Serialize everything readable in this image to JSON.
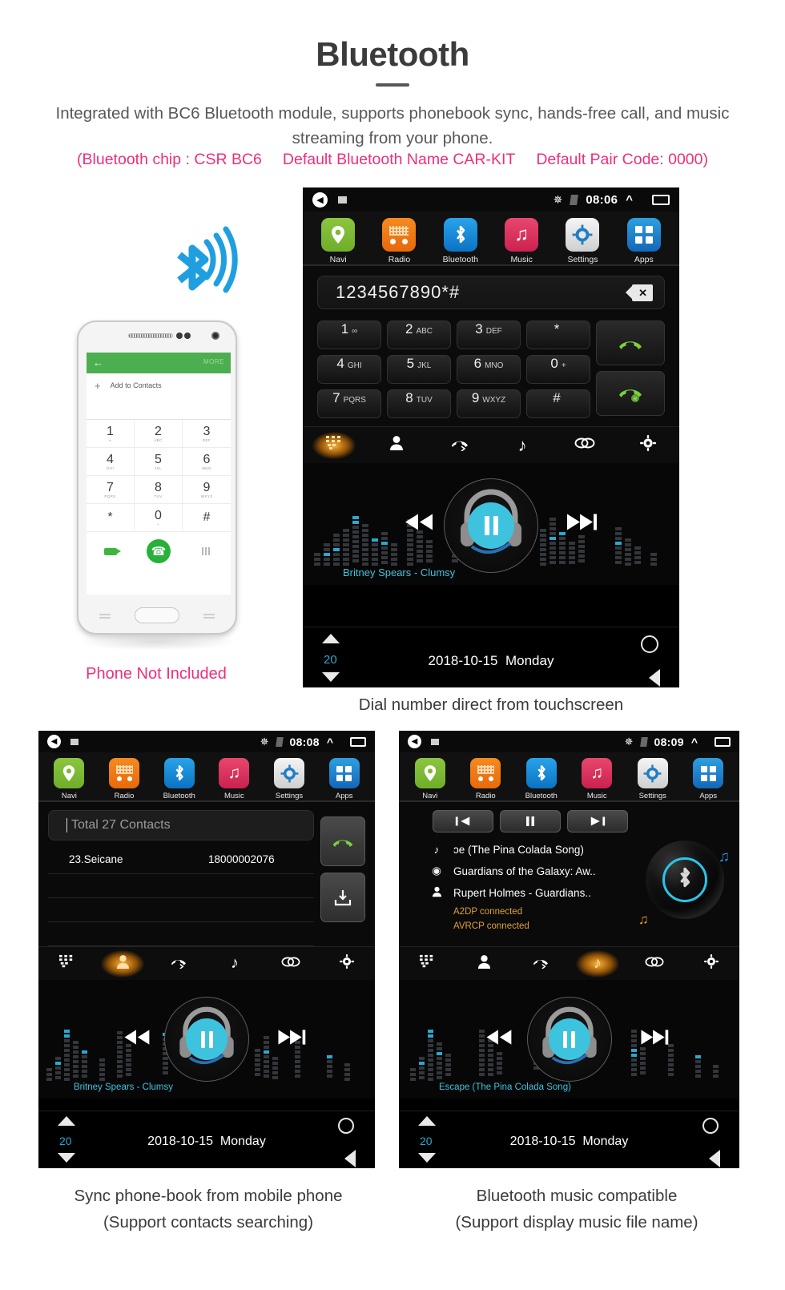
{
  "header": {
    "title": "Bluetooth",
    "subtitle": "Integrated with BC6 Bluetooth module, supports phonebook sync, hands-free call, and music streaming from your phone.",
    "spec_chip": "(Bluetooth chip : CSR BC6",
    "spec_name": "Default Bluetooth Name CAR-KIT",
    "spec_pair": "Default Pair Code: 0000)",
    "accent_pink": "#ef2e7c",
    "accent_grey": "#585858"
  },
  "phone_mock": {
    "appbar_more": "MORE",
    "add_to_contacts": "Add to Contacts",
    "keys": [
      {
        "d": "1",
        "s": "∞"
      },
      {
        "d": "2",
        "s": "ABC"
      },
      {
        "d": "3",
        "s": "DEF"
      },
      {
        "d": "4",
        "s": "GHI"
      },
      {
        "d": "5",
        "s": "JKL"
      },
      {
        "d": "6",
        "s": "MNO"
      },
      {
        "d": "7",
        "s": "PQRS"
      },
      {
        "d": "8",
        "s": "TUV"
      },
      {
        "d": "9",
        "s": "WXYZ"
      },
      {
        "d": "*",
        "s": ""
      },
      {
        "d": "0",
        "s": "+"
      },
      {
        "d": "#",
        "s": ""
      }
    ],
    "caption": "Phone Not Included"
  },
  "main_unit": {
    "status": {
      "time": "08:06"
    },
    "apps": [
      {
        "label": "Navi",
        "icon": "location-pin-icon"
      },
      {
        "label": "Radio",
        "icon": "radio-icon"
      },
      {
        "label": "Bluetooth",
        "icon": "bluetooth-icon"
      },
      {
        "label": "Music",
        "icon": "music-note-icon"
      },
      {
        "label": "Settings",
        "icon": "gear-icon"
      },
      {
        "label": "Apps",
        "icon": "grid-apps-icon"
      }
    ],
    "dialer": {
      "number": "1234567890*#",
      "keys": [
        {
          "d": "1",
          "s": "∞"
        },
        {
          "d": "2",
          "s": "ABC"
        },
        {
          "d": "3",
          "s": "DEF"
        },
        {
          "d": "*",
          "s": ""
        },
        {
          "d": "4",
          "s": "GHI"
        },
        {
          "d": "5",
          "s": "JKL"
        },
        {
          "d": "6",
          "s": "MNO"
        },
        {
          "d": "0",
          "s": "+"
        },
        {
          "d": "7",
          "s": "PQRS"
        },
        {
          "d": "8",
          "s": "TUV"
        },
        {
          "d": "9",
          "s": "WXYZ"
        },
        {
          "d": "#",
          "s": ""
        }
      ]
    },
    "tabs": [
      {
        "name": "dialpad",
        "active": true
      },
      {
        "name": "contacts",
        "active": false
      },
      {
        "name": "call-history",
        "active": false
      },
      {
        "name": "bt-music",
        "active": false
      },
      {
        "name": "link",
        "active": false
      },
      {
        "name": "settings",
        "active": false
      }
    ],
    "player": {
      "song": "Britney Spears - Clumsy",
      "state": "playing"
    },
    "bottom": {
      "volume": "20",
      "date": "2018-10-15",
      "weekday": "Monday"
    },
    "caption": "Dial number direct from touchscreen"
  },
  "contacts_unit": {
    "status": {
      "time": "08:08"
    },
    "search_placeholder": "Total 27 Contacts",
    "rows": [
      {
        "name": "23.Seicane",
        "number": "18000002076"
      }
    ],
    "side_buttons": [
      "dial-call-button",
      "download-contacts-button"
    ],
    "player": {
      "song": "Britney Spears - Clumsy"
    },
    "bottom": {
      "volume": "20",
      "date": "2018-10-15",
      "weekday": "Monday"
    },
    "caption_line1": "Sync phone-book from mobile phone",
    "caption_line2": "(Support contacts searching)"
  },
  "btmusic_unit": {
    "status": {
      "time": "08:09"
    },
    "controls": [
      "prev-track-button",
      "pause-button",
      "next-track-button"
    ],
    "track": "ɔe (The Pina Colada Song)",
    "album": "Guardians of the Galaxy: Aw..",
    "artist": "Rupert Holmes - Guardians..",
    "a2dp_status": "A2DP  connected",
    "avrcp_status": "AVRCP  connected",
    "player": {
      "song": "Escape (The Pina Colada Song)"
    },
    "bottom": {
      "volume": "20",
      "date": "2018-10-15",
      "weekday": "Monday"
    },
    "caption_line1": "Bluetooth music compatible",
    "caption_line2": "(Support display music file name)"
  },
  "colors": {
    "cyan": "#3dc3dd",
    "green": "#79d13c",
    "orange_glow": "#ffb23a",
    "bt_blue": "#1f9fe0"
  }
}
